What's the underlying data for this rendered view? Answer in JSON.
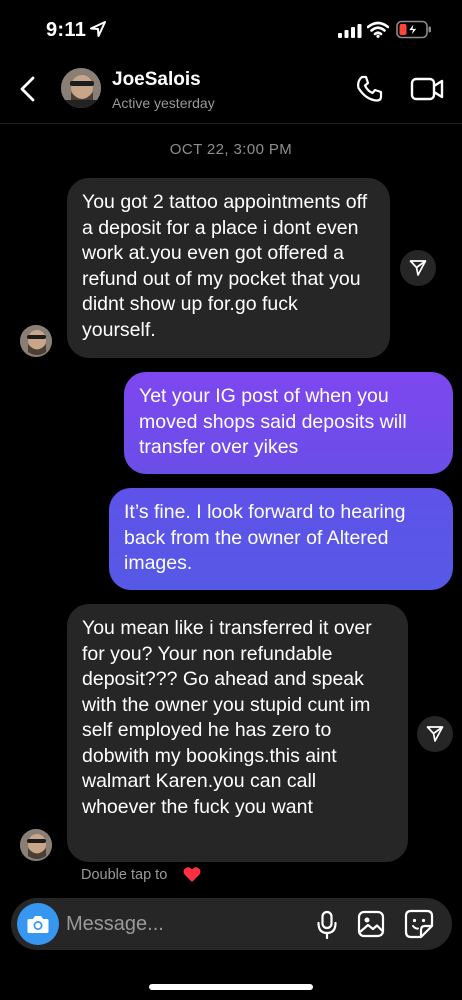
{
  "status_bar": {
    "time": "9:11",
    "icons": [
      "location-arrow-icon",
      "cellular-signal-icon",
      "wifi-icon",
      "battery-charging-icon"
    ]
  },
  "header": {
    "contact_name": "JoeSalois",
    "contact_status": "Active yesterday",
    "icons": [
      "back-chevron-icon",
      "phone-icon",
      "video-camera-icon"
    ]
  },
  "conversation": {
    "date_stamp": "OCT 22, 3:00 PM",
    "messages": [
      {
        "direction": "incoming",
        "text": "You got 2 tattoo appointments off a deposit for a place i dont even work at.you even got offered a refund out of my pocket that you didnt show up for.go fuck yourself."
      },
      {
        "direction": "outgoing",
        "text": "Yet your IG post of when you moved shops said deposits will transfer over yikes"
      },
      {
        "direction": "outgoing",
        "text": "It’s fine. I look forward to hearing back from the owner of Altered images."
      },
      {
        "direction": "incoming",
        "text": "You mean like i transferred it over for you? Your non refundable deposit??? Go ahead and speak with the owner you stupid cunt im self employed he has zero to dobwith my bookings.this aint walmart Karen.you can call whoever the fuck you want"
      }
    ],
    "double_tap_hint": "Double tap to"
  },
  "composer": {
    "placeholder": "Message...",
    "icons": [
      "camera-icon",
      "microphone-icon",
      "gallery-icon",
      "sticker-icon"
    ]
  },
  "colors": {
    "background": "#000000",
    "incoming_bubble": "#262626",
    "outgoing_bubble_top": "#7e47f0",
    "outgoing_bubble_bottom": "#5659e6",
    "camera_button": "#3797f0",
    "secondary_text": "#9a9a9a",
    "heart": "#ff3040"
  }
}
